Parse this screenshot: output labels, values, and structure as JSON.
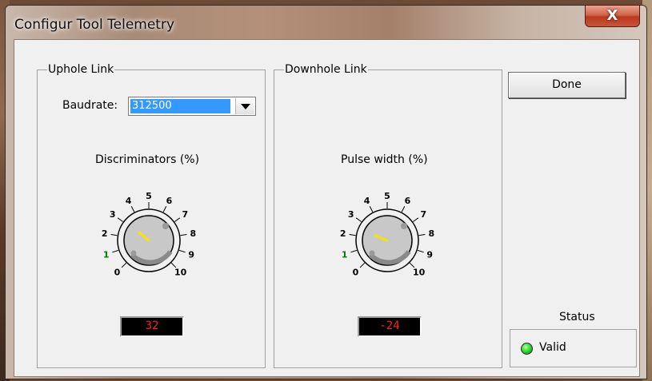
{
  "window": {
    "title": "Configur Tool Telemetry",
    "close_glyph": "X"
  },
  "uphole": {
    "group_label": "Uphole Link",
    "baudrate_label": "Baudrate:",
    "baudrate_value": "312500",
    "knob_title": "Discriminators (%)",
    "readout": "32"
  },
  "downhole": {
    "group_label": "Downhole Link",
    "knob_title": "Pulse width (%)",
    "readout": "-24"
  },
  "knob_scale": [
    "0",
    "1",
    "2",
    "3",
    "4",
    "5",
    "6",
    "7",
    "8",
    "9",
    "10"
  ],
  "done_label": "Done",
  "status": {
    "title": "Status",
    "value": "Valid",
    "led_color": "#2bd62b"
  },
  "colors": {
    "pointer": "#f2e600",
    "readout_text": "#ff2020",
    "selection": "#3399ff"
  },
  "icons": {
    "close": "close-icon",
    "dropdown": "chevron-down-icon",
    "led": "status-led-icon"
  }
}
